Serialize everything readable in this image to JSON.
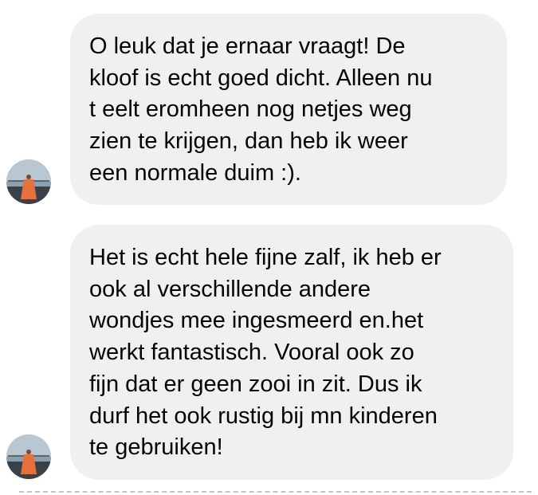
{
  "messages": [
    {
      "lines": [
        "O leuk dat je ernaar vraagt! De",
        "kloof is echt goed dicht. Alleen nu",
        "t eelt eromheen nog netjes weg",
        "zien te krijgen, dan heb ik weer",
        "een normale duim :)."
      ]
    },
    {
      "lines": [
        "Het is echt hele fijne zalf, ik heb er",
        "ook al verschillende andere",
        "wondjes mee ingesmeerd en.het",
        "werkt fantastisch. Vooral ook zo",
        "fijn dat er geen zooi in zit. Dus ik",
        "durf het ook rustig bij mn kinderen",
        "te gebruiken!"
      ]
    }
  ],
  "colors": {
    "bubble_background": "#f0f0f2",
    "text": "#050505",
    "divider": "#c4c4c8"
  },
  "icons": {
    "avatar": "user-photo-avatar-icon"
  }
}
